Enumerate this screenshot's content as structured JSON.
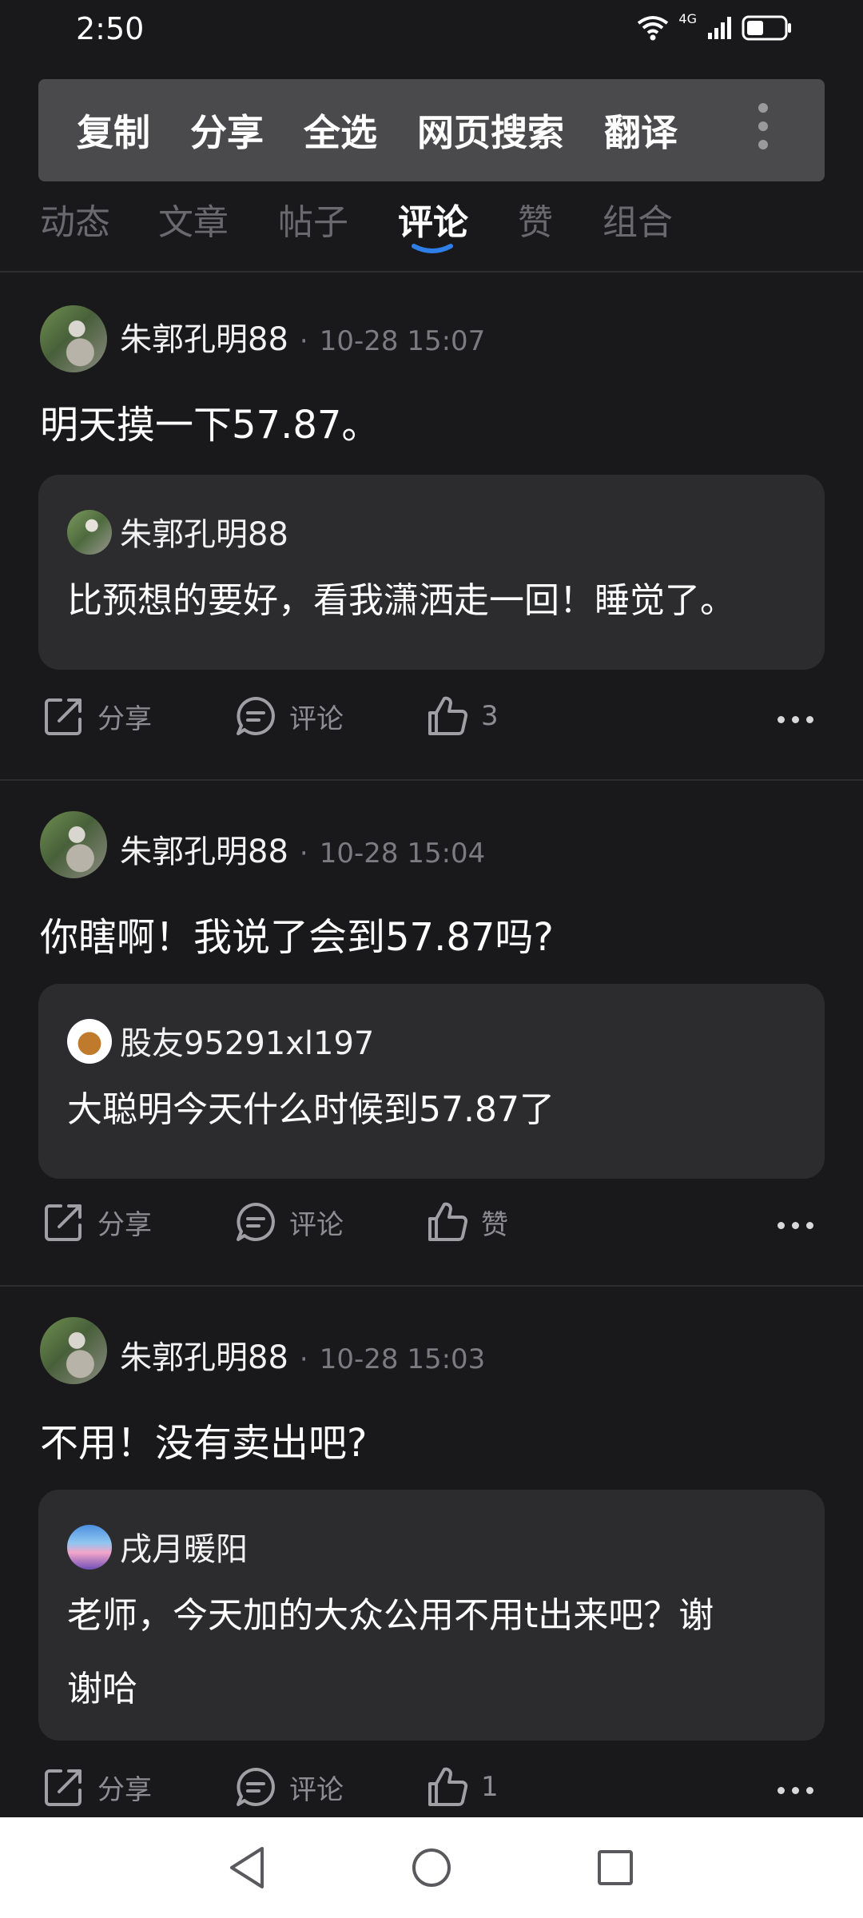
{
  "status_bar": {
    "time": "2:50",
    "network": "4G"
  },
  "context_menu": {
    "items": [
      "复制",
      "分享",
      "全选",
      "网页搜索",
      "翻译"
    ]
  },
  "tabs": [
    "动态",
    "文章",
    "帖子",
    "评论",
    "赞",
    "组合"
  ],
  "active_tab": "评论",
  "posts": [
    {
      "author": "朱郭孔明88",
      "separator": "·",
      "time": "10-28 15:07",
      "text": "明天摸一下57.87。",
      "quote": {
        "author": "朱郭孔明88",
        "text": "比预想的要好，看我潇洒走一回！睡觉了。"
      },
      "actions": {
        "share": "分享",
        "comment": "评论",
        "like": "3"
      }
    },
    {
      "author": "朱郭孔明88",
      "separator": "·",
      "time": "10-28 15:04",
      "text": "你瞎啊！我说了会到57.87吗?",
      "quote": {
        "author": "股友95291xl197",
        "text": "大聪明今天什么时候到57.87了"
      },
      "actions": {
        "share": "分享",
        "comment": "评论",
        "like": "赞"
      }
    },
    {
      "author": "朱郭孔明88",
      "separator": "·",
      "time": "10-28 15:03",
      "text": "不用！没有卖出吧?",
      "quote": {
        "author": "戌月暖阳",
        "text_line1": "老师，今天加的大众公用不用t出来吧？谢",
        "text_line2": "谢哈"
      },
      "actions": {
        "share": "分享",
        "comment": "评论",
        "like": "1"
      }
    }
  ]
}
